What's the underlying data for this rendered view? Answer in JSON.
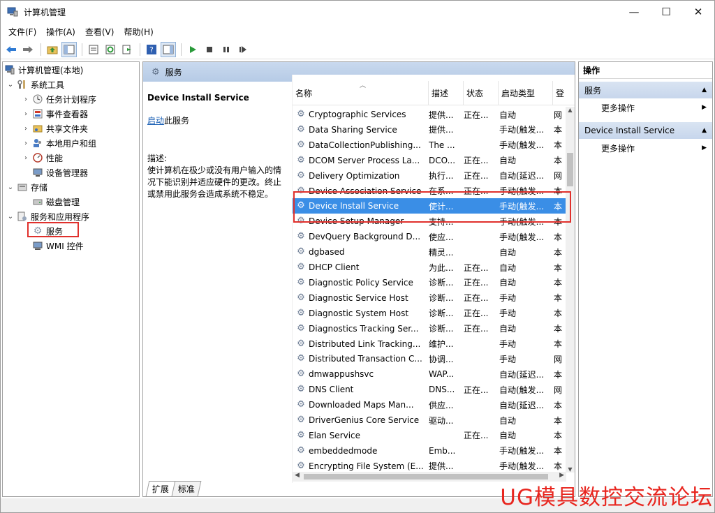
{
  "window": {
    "title": "计算机管理"
  },
  "window_buttons": {
    "minimize": "—",
    "maximize": "☐",
    "close": "✕"
  },
  "menu": [
    "文件(F)",
    "操作(A)",
    "查看(V)",
    "帮助(H)"
  ],
  "tree": {
    "root": "计算机管理(本地)",
    "system_tools": "系统工具",
    "task_scheduler": "任务计划程序",
    "event_viewer": "事件查看器",
    "shared_folders": "共享文件夹",
    "local_users": "本地用户和组",
    "performance": "性能",
    "device_manager": "设备管理器",
    "storage": "存储",
    "disk_management": "磁盘管理",
    "services_apps": "服务和应用程序",
    "services": "服务",
    "wmi": "WMI 控件"
  },
  "center": {
    "header": "服务",
    "selected_title": "Device Install Service",
    "start_link": "启动",
    "start_suffix": "此服务",
    "desc_label": "描述:",
    "desc_text": "使计算机在极少或没有用户输入的情况下能识别并适应硬件的更改。终止或禁用此服务会造成系统不稳定。"
  },
  "columns": {
    "name": "名称",
    "desc": "描述",
    "status": "状态",
    "startup": "启动类型",
    "logon": "登"
  },
  "services": [
    {
      "name": "Cryptographic Services",
      "desc": "提供...",
      "status": "正在...",
      "startup": "自动",
      "logon": "网"
    },
    {
      "name": "Data Sharing Service",
      "desc": "提供...",
      "status": "",
      "startup": "手动(触发...",
      "logon": "本"
    },
    {
      "name": "DataCollectionPublishing...",
      "desc": "The ...",
      "status": "",
      "startup": "手动(触发...",
      "logon": "本"
    },
    {
      "name": "DCOM Server Process La...",
      "desc": "DCO...",
      "status": "正在...",
      "startup": "自动",
      "logon": "本"
    },
    {
      "name": "Delivery Optimization",
      "desc": "执行...",
      "status": "正在...",
      "startup": "自动(延迟...",
      "logon": "网"
    },
    {
      "name": "Device Association Service",
      "desc": "在系...",
      "status": "正在...",
      "startup": "手动(触发...",
      "logon": "本"
    },
    {
      "name": "Device Install Service",
      "desc": "使计...",
      "status": "",
      "startup": "手动(触发...",
      "logon": "本"
    },
    {
      "name": "Device Setup Manager",
      "desc": "支持...",
      "status": "",
      "startup": "手动(触发...",
      "logon": "本"
    },
    {
      "name": "DevQuery Background D...",
      "desc": "使应...",
      "status": "",
      "startup": "手动(触发...",
      "logon": "本"
    },
    {
      "name": "dgbased",
      "desc": "精灵...",
      "status": "",
      "startup": "自动",
      "logon": "本"
    },
    {
      "name": "DHCP Client",
      "desc": "为此...",
      "status": "正在...",
      "startup": "自动",
      "logon": "本"
    },
    {
      "name": "Diagnostic Policy Service",
      "desc": "诊断...",
      "status": "正在...",
      "startup": "自动",
      "logon": "本"
    },
    {
      "name": "Diagnostic Service Host",
      "desc": "诊断...",
      "status": "正在...",
      "startup": "手动",
      "logon": "本"
    },
    {
      "name": "Diagnostic System Host",
      "desc": "诊断...",
      "status": "正在...",
      "startup": "手动",
      "logon": "本"
    },
    {
      "name": "Diagnostics Tracking Ser...",
      "desc": "诊断...",
      "status": "正在...",
      "startup": "自动",
      "logon": "本"
    },
    {
      "name": "Distributed Link Tracking...",
      "desc": "维护...",
      "status": "",
      "startup": "手动",
      "logon": "本"
    },
    {
      "name": "Distributed Transaction C...",
      "desc": "协调...",
      "status": "",
      "startup": "手动",
      "logon": "网"
    },
    {
      "name": "dmwappushsvc",
      "desc": "WAP...",
      "status": "",
      "startup": "自动(延迟...",
      "logon": "本"
    },
    {
      "name": "DNS Client",
      "desc": "DNS...",
      "status": "正在...",
      "startup": "自动(触发...",
      "logon": "网"
    },
    {
      "name": "Downloaded Maps Man...",
      "desc": "供应...",
      "status": "",
      "startup": "自动(延迟...",
      "logon": "本"
    },
    {
      "name": "DriverGenius Core Service",
      "desc": "驱动...",
      "status": "",
      "startup": "自动",
      "logon": "本"
    },
    {
      "name": "Elan Service",
      "desc": "",
      "status": "正在...",
      "startup": "自动",
      "logon": "本"
    },
    {
      "name": "embeddedmode",
      "desc": "Emb...",
      "status": "",
      "startup": "手动(触发...",
      "logon": "本"
    },
    {
      "name": "Encrypting File System (E...",
      "desc": "提供...",
      "status": "",
      "startup": "手动(触发...",
      "logon": "本"
    }
  ],
  "selected_index": 6,
  "tabs": [
    "扩展",
    "标准"
  ],
  "actions": {
    "header": "操作",
    "group1": "服务",
    "more1": "更多操作",
    "group2": "Device Install Service",
    "more2": "更多操作"
  },
  "watermark": "UG模具数控交流论坛"
}
